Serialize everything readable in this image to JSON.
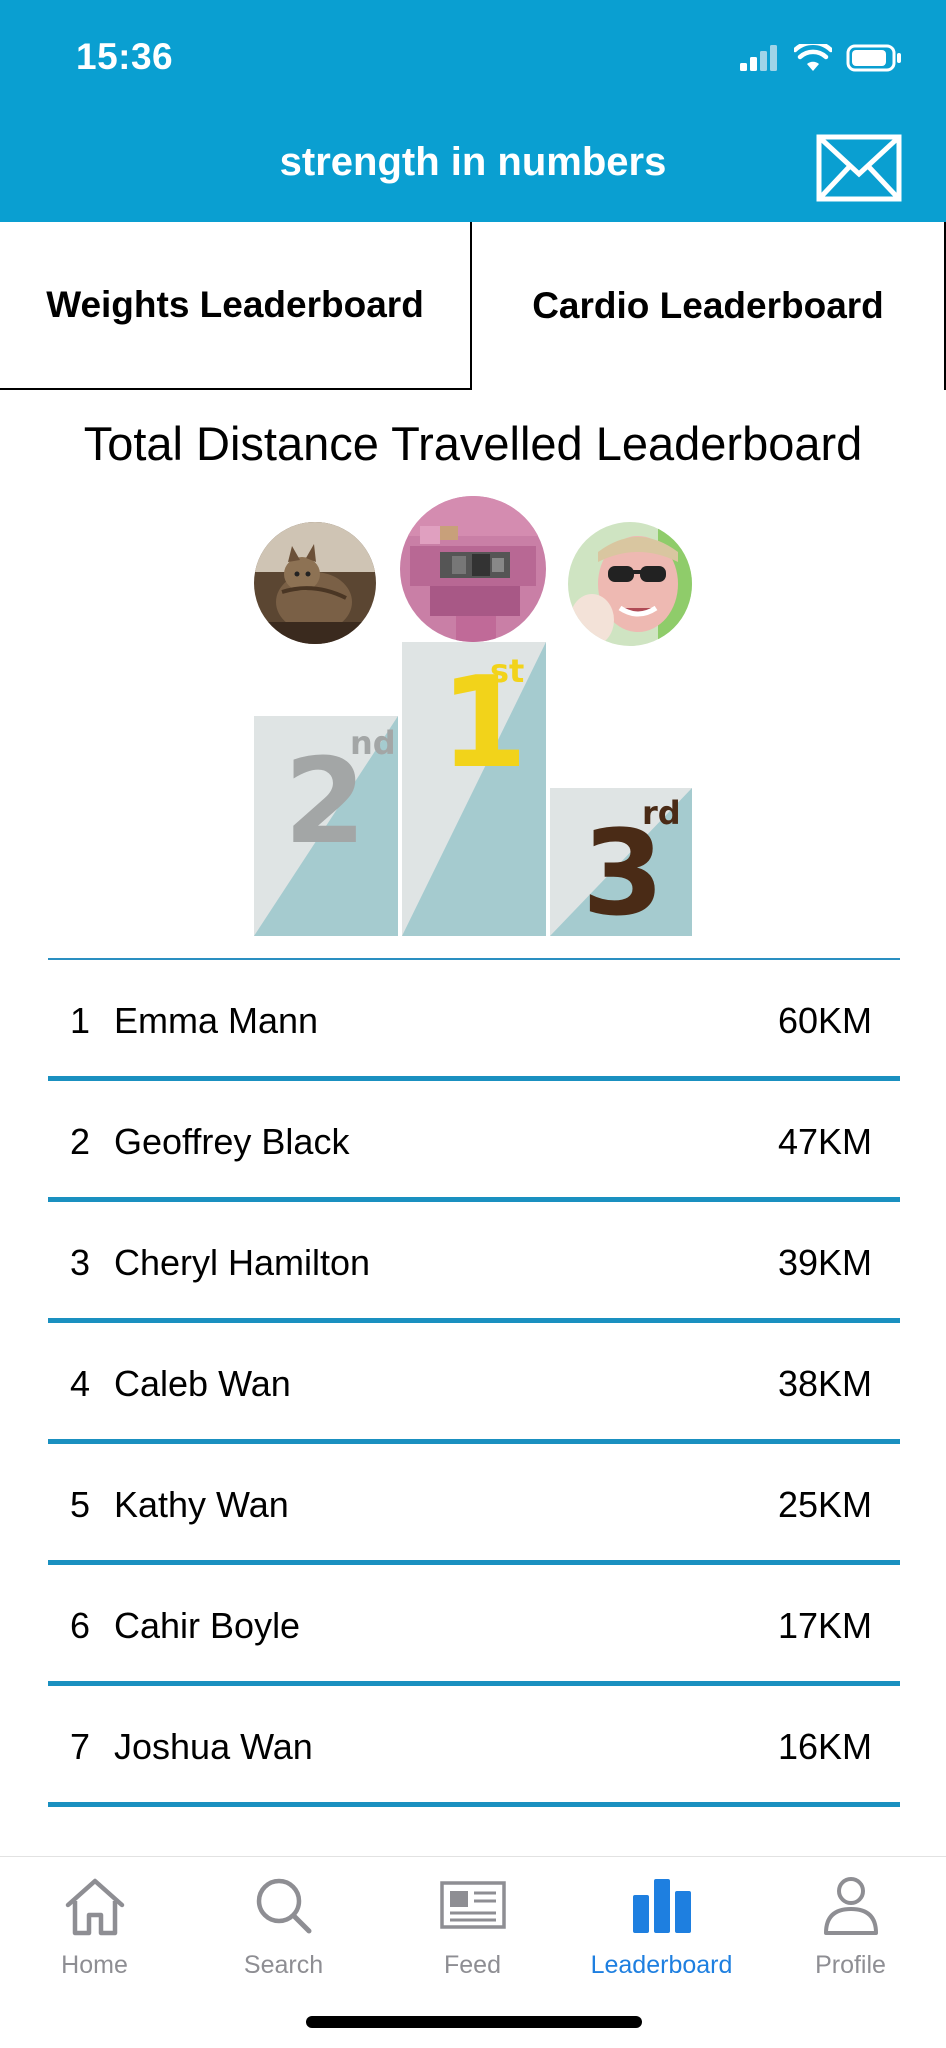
{
  "status_bar": {
    "time": "15:36"
  },
  "header": {
    "title": "strength in numbers",
    "mail_icon": "envelope-icon"
  },
  "tabs": [
    {
      "label": "Weights Leaderboard"
    },
    {
      "label": "Cardio Leaderboard"
    }
  ],
  "leaderboard": {
    "title": "Total Distance Travelled Leaderboard",
    "podium": {
      "first": "1",
      "first_suffix": "st",
      "second": "2",
      "second_suffix": "nd",
      "third": "3",
      "third_suffix": "rd"
    },
    "rows": [
      {
        "rank": "1",
        "name": "Emma Mann",
        "distance": "60KM"
      },
      {
        "rank": "2",
        "name": "Geoffrey Black",
        "distance": "47KM"
      },
      {
        "rank": "3",
        "name": "Cheryl Hamilton",
        "distance": "39KM"
      },
      {
        "rank": "4",
        "name": "Caleb Wan",
        "distance": "38KM"
      },
      {
        "rank": "5",
        "name": "Kathy Wan",
        "distance": "25KM"
      },
      {
        "rank": "6",
        "name": "Cahir Boyle",
        "distance": "17KM"
      },
      {
        "rank": "7",
        "name": "Joshua Wan",
        "distance": "16KM"
      }
    ]
  },
  "bottom_nav": [
    {
      "label": "Home",
      "icon": "home-icon",
      "active": false
    },
    {
      "label": "Search",
      "icon": "search-icon",
      "active": false
    },
    {
      "label": "Feed",
      "icon": "newspaper-icon",
      "active": false
    },
    {
      "label": "Leaderboard",
      "icon": "bar-chart-icon",
      "active": true
    },
    {
      "label": "Profile",
      "icon": "person-icon",
      "active": false
    }
  ],
  "colors": {
    "header_bg": "#0a9fd1",
    "row_divider": "#1a90c0",
    "nav_active": "#1e7fe0",
    "nav_inactive": "#8e8e93"
  }
}
